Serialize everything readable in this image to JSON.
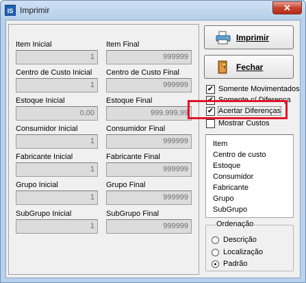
{
  "window": {
    "title": "Imprimir",
    "app_icon_text": "IS",
    "close_glyph": "✕"
  },
  "fields": [
    {
      "label": "Item Inicial",
      "value": "1"
    },
    {
      "label": "Item Final",
      "value": "999999"
    },
    {
      "label": "Centro de Custo Inicial",
      "value": "1"
    },
    {
      "label": "Centro de Custo Final",
      "value": "999999"
    },
    {
      "label": "Estoque Inicial",
      "value": "0,00"
    },
    {
      "label": "Estoque Final",
      "value": "999.999,99"
    },
    {
      "label": "Consumidor Inicial",
      "value": "1"
    },
    {
      "label": "Consumidor Final",
      "value": "999999"
    },
    {
      "label": "Fabricante Inicial",
      "value": "1"
    },
    {
      "label": "Fabricante Final",
      "value": "999999"
    },
    {
      "label": "Grupo Inicial",
      "value": "1"
    },
    {
      "label": "Grupo Final",
      "value": "999999"
    },
    {
      "label": "SubGrupo Inicial",
      "value": "1"
    },
    {
      "label": "SubGrupo Final",
      "value": "999999"
    }
  ],
  "buttons": {
    "print_label": "Imprimir",
    "close_label": "Fechar",
    "print_icon": "printer-icon",
    "close_icon": "exit-door-icon"
  },
  "options": [
    {
      "label": "Somente Movimentados",
      "checked": true,
      "mark": "✔"
    },
    {
      "label": "Somente c/ Diferença",
      "checked": true,
      "mark": "✔"
    },
    {
      "label": "Acertar Diferenças",
      "checked": true,
      "mark": "✔"
    },
    {
      "label": "Mostrar Custos",
      "checked": false,
      "mark": ""
    }
  ],
  "sort_list": [
    "Item",
    "Centro de custo",
    "Estoque",
    "Consumidor",
    "Fabricante",
    "Grupo",
    "SubGrupo"
  ],
  "ordering": {
    "title": "Ordenação",
    "choices": [
      {
        "label": "Descrição",
        "selected": false
      },
      {
        "label": "Localização",
        "selected": false
      },
      {
        "label": "Padrão",
        "selected": true
      }
    ]
  },
  "colors": {
    "highlight": "#e0142a",
    "window_frame": "#b9d1ea",
    "close_button": "#c7432f"
  }
}
